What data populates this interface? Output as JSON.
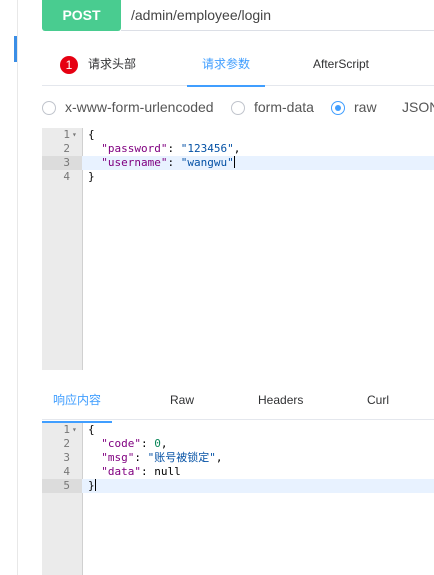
{
  "request": {
    "method": "POST",
    "url": "/admin/employee/login"
  },
  "request_tabs": {
    "headers_badge": "1",
    "headers": "请求头部",
    "params": "请求参数",
    "after_script": "AfterScript"
  },
  "body_types": {
    "urlencoded": "x-www-form-urlencoded",
    "form_data": "form-data",
    "raw": "raw",
    "json": "JSON",
    "selected": "raw"
  },
  "request_body": {
    "line_numbers": [
      "1",
      "2",
      "3",
      "4"
    ],
    "lines": [
      "{",
      "\"password\": \"123456\",",
      "\"username\": \"wangwu\"",
      "}"
    ],
    "password_key": "\"password\"",
    "password_value": "\"123456\"",
    "username_key": "\"username\"",
    "username_value": "\"wangwu\""
  },
  "response_tabs": {
    "content": "响应内容",
    "raw": "Raw",
    "headers": "Headers",
    "curl": "Curl"
  },
  "response_body": {
    "line_numbers": [
      "1",
      "2",
      "3",
      "4",
      "5"
    ],
    "code_key": "\"code\"",
    "code_value": "0",
    "msg_key": "\"msg\"",
    "msg_value": "\"账号被锁定\"",
    "data_key": "\"data\"",
    "data_value": "null"
  },
  "colors": {
    "post_green": "#49cc90",
    "active_blue": "#409eff",
    "badge_red": "#e60012"
  }
}
